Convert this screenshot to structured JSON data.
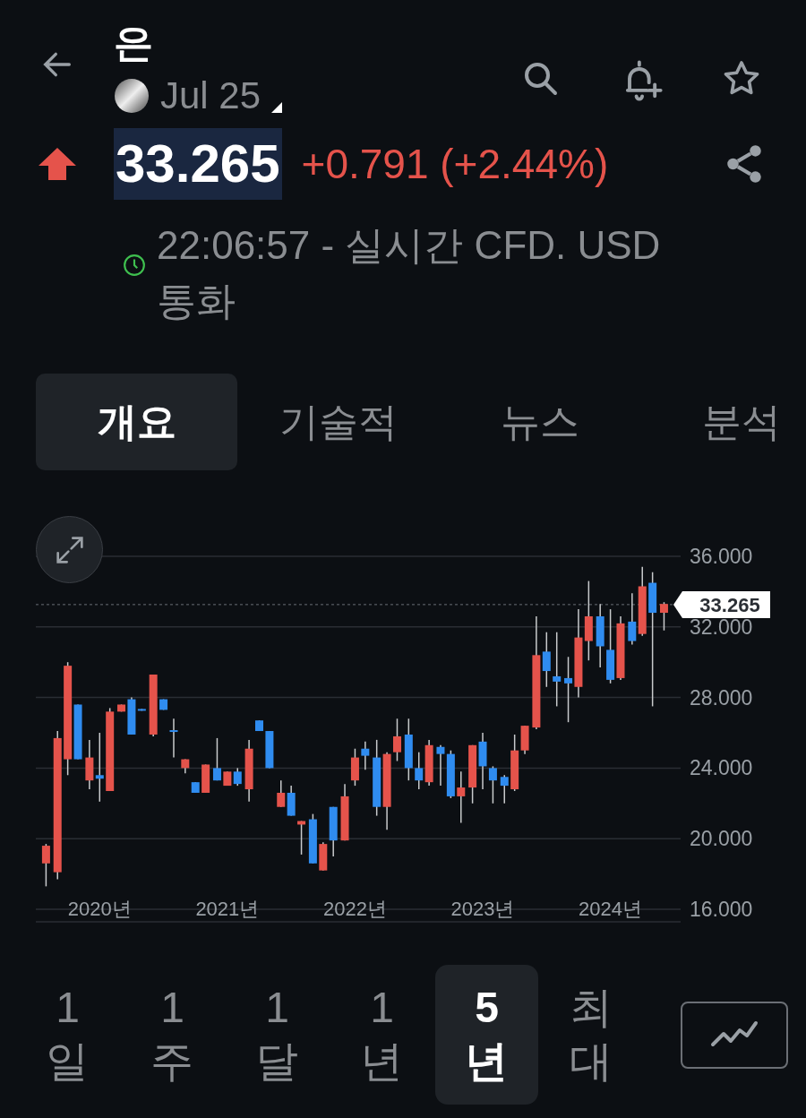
{
  "header": {
    "title": "은",
    "contract": "Jul 25"
  },
  "quote": {
    "rising": true,
    "price": "33.265",
    "change": "+0.791 (+2.44%)",
    "timestamp": "22:06:57 - 실시간 CFD. USD 통화",
    "market_open": true
  },
  "tabs": [
    {
      "label": "개요",
      "selected": true
    },
    {
      "label": "기술적",
      "selected": false
    },
    {
      "label": "뉴스",
      "selected": false
    },
    {
      "label": "분석",
      "selected": false
    }
  ],
  "chart": {
    "chart_data": {
      "type": "candlestick",
      "grid": true,
      "x": [
        2019.58,
        2019.67,
        2019.75,
        2019.83,
        2019.92,
        2020.0,
        2020.08,
        2020.17,
        2020.25,
        2020.33,
        2020.42,
        2020.5,
        2020.58,
        2020.67,
        2020.75,
        2020.83,
        2020.92,
        2021.0,
        2021.08,
        2021.17,
        2021.25,
        2021.33,
        2021.42,
        2021.5,
        2021.58,
        2021.67,
        2021.75,
        2021.83,
        2021.92,
        2022.0,
        2022.08,
        2022.17,
        2022.25,
        2022.33,
        2022.42,
        2022.5,
        2022.58,
        2022.67,
        2022.75,
        2022.83,
        2022.92,
        2023.0,
        2023.08,
        2023.17,
        2023.25,
        2023.33,
        2023.42,
        2023.5,
        2023.58,
        2023.67,
        2023.75,
        2023.83,
        2023.92,
        2024.0,
        2024.08,
        2024.17,
        2024.25,
        2024.33,
        2024.42
      ],
      "ohlc": [
        [
          18.6,
          19.7,
          17.3,
          19.6
        ],
        [
          18.1,
          26.1,
          17.7,
          25.7
        ],
        [
          24.5,
          30.0,
          23.6,
          29.8
        ],
        [
          27.6,
          27.6,
          24.5,
          24.5
        ],
        [
          23.3,
          25.6,
          22.8,
          24.6
        ],
        [
          23.6,
          26.0,
          22.1,
          23.4
        ],
        [
          22.7,
          27.4,
          22.7,
          27.2
        ],
        [
          27.2,
          27.6,
          27.2,
          27.6
        ],
        [
          27.9,
          28.0,
          25.9,
          25.9
        ],
        [
          27.35,
          27.35,
          27.25,
          27.25
        ],
        [
          25.9,
          29.3,
          25.8,
          29.3
        ],
        [
          27.9,
          27.9,
          27.3,
          27.3
        ],
        [
          26.15,
          26.8,
          24.6,
          26.05
        ],
        [
          24.0,
          24.5,
          23.7,
          24.5
        ],
        [
          23.2,
          23.2,
          22.6,
          22.6
        ],
        [
          22.6,
          24.2,
          22.6,
          24.2
        ],
        [
          24.0,
          25.7,
          23.3,
          23.3
        ],
        [
          23.0,
          23.8,
          23.0,
          23.8
        ],
        [
          23.8,
          24.0,
          23.0,
          23.1
        ],
        [
          22.8,
          25.6,
          22.1,
          25.1
        ],
        [
          26.7,
          26.7,
          26.1,
          26.1
        ],
        [
          26.1,
          26.1,
          24.0,
          24.0
        ],
        [
          21.8,
          23.3,
          21.8,
          22.6
        ],
        [
          22.6,
          23.0,
          21.3,
          21.3
        ],
        [
          20.8,
          21.0,
          19.1,
          21.0
        ],
        [
          21.1,
          21.4,
          18.6,
          18.6
        ],
        [
          18.2,
          19.8,
          18.2,
          19.7
        ],
        [
          21.8,
          21.8,
          19.0,
          19.9
        ],
        [
          19.9,
          23.1,
          19.9,
          22.4
        ],
        [
          23.3,
          25.1,
          23.0,
          24.6
        ],
        [
          25.1,
          25.5,
          23.9,
          24.7
        ],
        [
          24.6,
          25.6,
          21.3,
          21.8
        ],
        [
          21.8,
          24.9,
          20.5,
          24.8
        ],
        [
          24.9,
          26.8,
          24.4,
          25.8
        ],
        [
          25.9,
          26.8,
          23.3,
          24.0
        ],
        [
          24.0,
          24.9,
          22.8,
          23.3
        ],
        [
          23.2,
          25.6,
          23.0,
          25.3
        ],
        [
          25.2,
          25.3,
          23.0,
          24.8
        ],
        [
          24.8,
          25.0,
          22.3,
          22.4
        ],
        [
          22.4,
          23.8,
          20.9,
          22.9
        ],
        [
          22.9,
          25.3,
          22.0,
          25.3
        ],
        [
          25.5,
          26.0,
          22.8,
          24.1
        ],
        [
          24.0,
          24.1,
          22.0,
          23.3
        ],
        [
          23.5,
          23.6,
          22.0,
          23.0
        ],
        [
          22.8,
          25.9,
          22.7,
          25.0
        ],
        [
          25.0,
          26.4,
          24.8,
          26.4
        ],
        [
          26.3,
          32.6,
          26.2,
          30.4
        ],
        [
          30.6,
          31.7,
          28.6,
          29.5
        ],
        [
          29.2,
          31.7,
          27.5,
          28.9
        ],
        [
          29.1,
          30.3,
          26.6,
          28.8
        ],
        [
          28.6,
          33.0,
          28.0,
          31.4
        ],
        [
          31.2,
          34.6,
          30.1,
          32.6
        ],
        [
          32.6,
          33.3,
          29.7,
          30.9
        ],
        [
          30.7,
          33.0,
          28.8,
          29.0
        ],
        [
          29.1,
          32.6,
          29.0,
          32.2
        ],
        [
          32.3,
          33.9,
          31.0,
          31.2
        ],
        [
          31.6,
          35.4,
          31.5,
          34.3
        ],
        [
          34.5,
          35.1,
          27.5,
          32.8
        ],
        [
          32.8,
          33.4,
          31.8,
          33.3
        ]
      ],
      "xlim": [
        2019.5,
        2024.55
      ],
      "ylim": [
        16,
        36
      ],
      "yticks": [
        {
          "value": 36,
          "label": "36.000"
        },
        {
          "value": 32,
          "label": "32.000"
        },
        {
          "value": 28,
          "label": "28.000"
        },
        {
          "value": 24,
          "label": "24.000"
        },
        {
          "value": 20,
          "label": "20.000"
        },
        {
          "value": 16,
          "label": "16.000"
        }
      ],
      "xticks": [
        {
          "value": 2020,
          "label": "2020년"
        },
        {
          "value": 2021,
          "label": "2021년"
        },
        {
          "value": 2022,
          "label": "2022년"
        },
        {
          "value": 2023,
          "label": "2023년"
        },
        {
          "value": 2024,
          "label": "2024년"
        }
      ],
      "ref_lines": [
        {
          "axis": "y",
          "value": 33.265,
          "label": "33.265"
        }
      ]
    }
  },
  "ranges": [
    {
      "label": "1 일",
      "selected": false
    },
    {
      "label": "1 주",
      "selected": false
    },
    {
      "label": "1 달",
      "selected": false
    },
    {
      "label": "1 년",
      "selected": false
    },
    {
      "label": "5 년",
      "selected": true
    },
    {
      "label": "최대",
      "selected": false
    }
  ]
}
